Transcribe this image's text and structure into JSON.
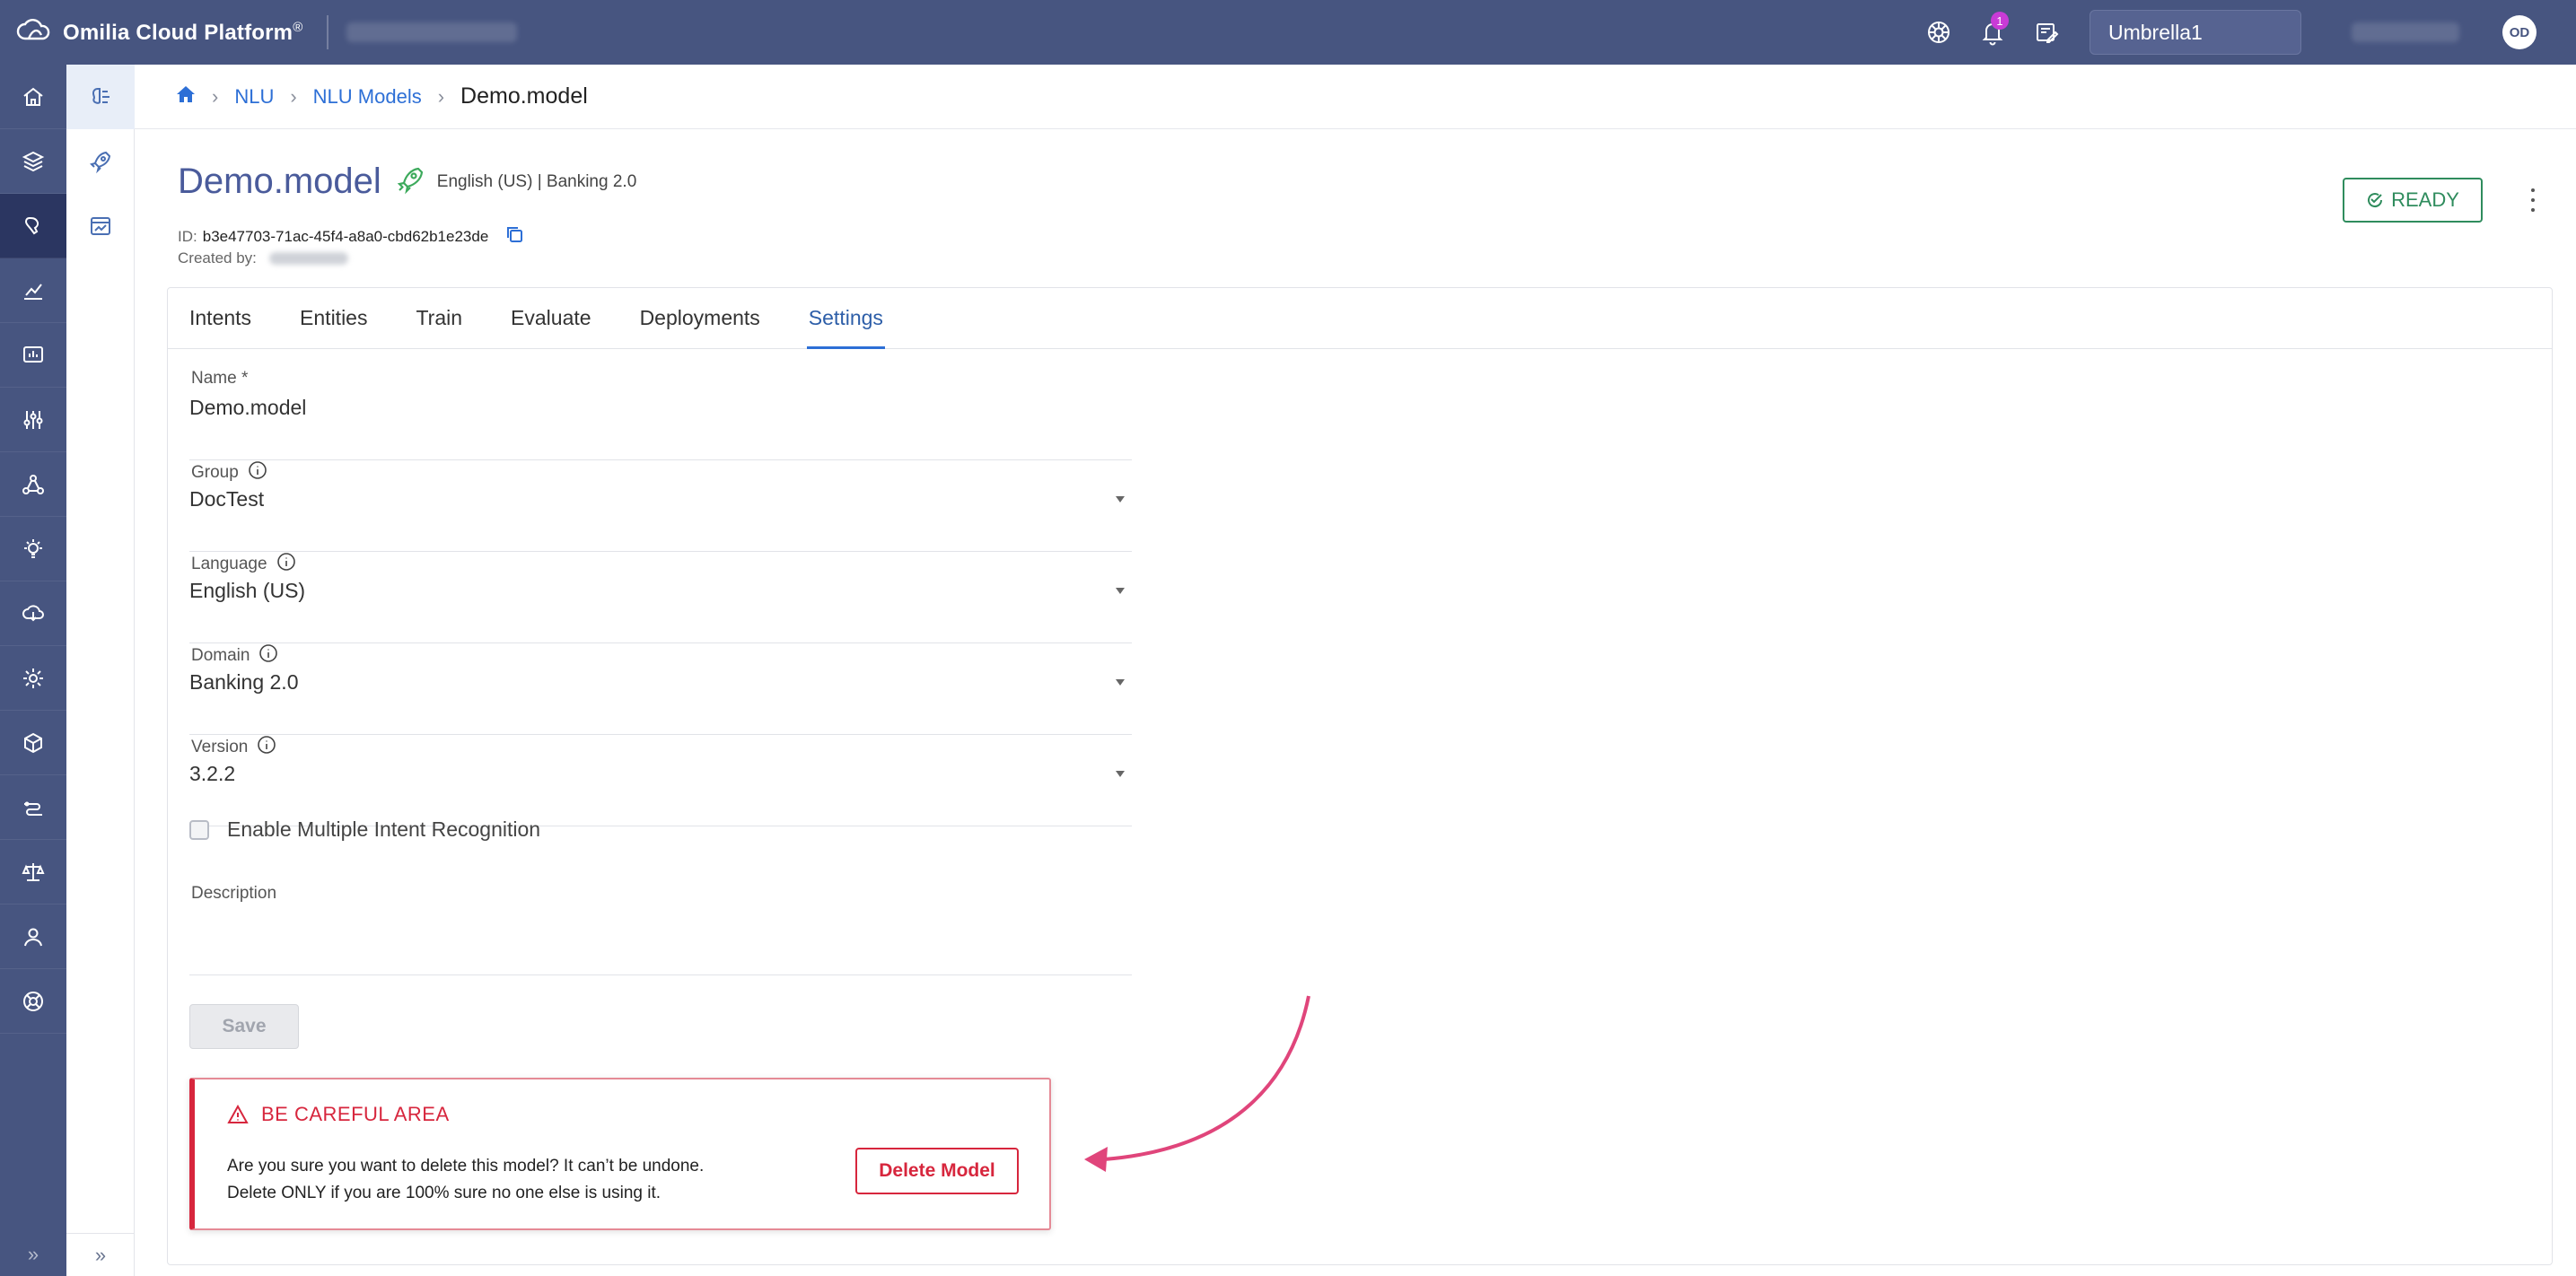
{
  "app": {
    "brand": "Omilia Cloud Platform",
    "brand_mark": "®",
    "notification_count": "1",
    "org": "Umbrella1",
    "avatar_initials": "OD"
  },
  "breadcrumb": {
    "items": [
      "NLU",
      "NLU Models"
    ],
    "current": "Demo.model"
  },
  "model": {
    "name": "Demo.model",
    "meta": "English (US) | Banking 2.0",
    "id_label": "ID:",
    "id_value": "b3e47703-71ac-45f4-a8a0-cbd62b1e23de",
    "created_by_label": "Created by:",
    "status": "READY"
  },
  "tabs": [
    "Intents",
    "Entities",
    "Train",
    "Evaluate",
    "Deployments",
    "Settings"
  ],
  "active_tab": "Settings",
  "form": {
    "name_label": "Name *",
    "name_value": "Demo.model",
    "group_label": "Group",
    "group_value": "DocTest",
    "language_label": "Language",
    "language_value": "English (US)",
    "domain_label": "Domain",
    "domain_value": "Banking 2.0",
    "version_label": "Version",
    "version_value": "3.2.2",
    "multi_intent_label": "Enable Multiple Intent Recognition",
    "description_label": "Description",
    "description_value": "",
    "save_label": "Save"
  },
  "danger_zone": {
    "title": "BE CAREFUL AREA",
    "line1": "Are you sure you want to delete this model? It can’t be undone.",
    "line2": "Delete ONLY if you are 100% sure no one else is using it.",
    "button": "Delete Model"
  },
  "colors": {
    "topbar": "#475580",
    "active_nav": "#2b3661",
    "link": "#2d6fd6",
    "title": "#4a5b9b",
    "ready": "#2f8c5d",
    "danger": "#d7263d",
    "annotation_arrow": "#e0457b"
  },
  "icons": {
    "left_nav": [
      "home-icon",
      "layers-icon",
      "nlu-icon",
      "analytics-icon",
      "dashboard-icon",
      "sliders-icon",
      "flow-icon",
      "bulb-icon",
      "cloud-icon",
      "settings-icon",
      "package-icon",
      "routing-icon",
      "scale-icon",
      "user-icon",
      "help-icon"
    ],
    "sub_nav": [
      "models-icon",
      "deployments-icon",
      "reports-icon"
    ]
  }
}
